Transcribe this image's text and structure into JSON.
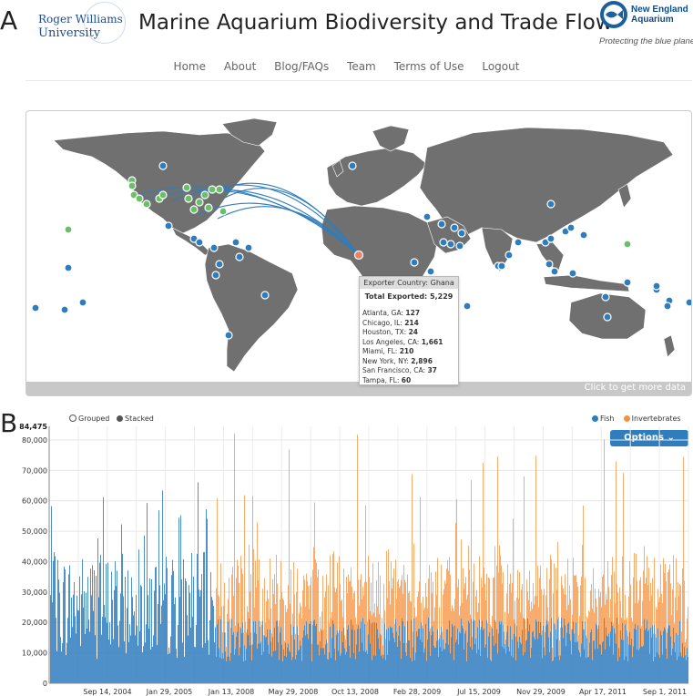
{
  "panel_labels": {
    "a": "A",
    "b": "B"
  },
  "header": {
    "left_logo_line1": "Roger Williams",
    "left_logo_line2": "University",
    "title": "Marine Aquarium Biodiversity and Trade Flow",
    "right_logo_line1": "New England",
    "right_logo_line2": "Aquarium",
    "right_logo_tagline": "Protecting the blue planet"
  },
  "nav": [
    "Home",
    "About",
    "Blog/FAQs",
    "Team",
    "Terms of Use",
    "Logout"
  ],
  "map": {
    "footer_text": "Click to get more data",
    "tooltip": {
      "header": "Exporter Country: Ghana",
      "total_label": "Total Exported:",
      "total_value": "5,229",
      "rows": [
        {
          "city": "Atlanta, GA:",
          "value": "127"
        },
        {
          "city": "Chicago, IL:",
          "value": "214"
        },
        {
          "city": "Houston, TX:",
          "value": "24"
        },
        {
          "city": "Los Angeles, CA:",
          "value": "1,661"
        },
        {
          "city": "Miami, FL:",
          "value": "210"
        },
        {
          "city": "New York, NY:",
          "value": "2,896"
        },
        {
          "city": "San Francisco, CA:",
          "value": "37"
        },
        {
          "city": "Tampa, FL:",
          "value": "60"
        }
      ]
    },
    "colors": {
      "land": "#707070",
      "ocean": "#ffffff",
      "exporter": "#2f7dbd",
      "importer": "#6bbf6b",
      "selected": "#e8826a",
      "flow": "#2f7dbd"
    }
  },
  "chart_controls": {
    "mode_grouped": "Grouped",
    "mode_stacked": "Stacked",
    "selected_mode": "Stacked",
    "options_button": "Options"
  },
  "chart_data": {
    "type": "bar",
    "stacked": true,
    "series": [
      {
        "name": "Fish",
        "color": "#2f7dbd"
      },
      {
        "name": "Invertebrates",
        "color": "#f5923e"
      }
    ],
    "ylim": [
      0,
      84475
    ],
    "y_max_label": "84,475",
    "y_ticks": [
      "0",
      "10,000",
      "20,000",
      "30,000",
      "40,000",
      "50,000",
      "60,000",
      "70,000",
      "80,000"
    ],
    "y_tick_values": [
      0,
      10000,
      20000,
      30000,
      40000,
      50000,
      60000,
      70000,
      80000
    ],
    "x_tick_labels": [
      "Sep 14, 2004",
      "Jan 29, 2005",
      "Jan 13, 2008",
      "May 29, 2008",
      "Oct 13, 2008",
      "Feb 28, 2009",
      "Jul 15, 2009",
      "Nov 29, 2009",
      "Apr 17, 2011",
      "Sep 1, 2011"
    ],
    "profile": {
      "segment_1": {
        "fish_typical": 32000,
        "fish_peak": 67000,
        "invertebrates_typical": 0
      },
      "segment_2": {
        "fish_typical": 18000,
        "invertebrates_typical": 20000,
        "total_peak": 84475
      }
    },
    "grid": true,
    "legend": "top-right"
  }
}
